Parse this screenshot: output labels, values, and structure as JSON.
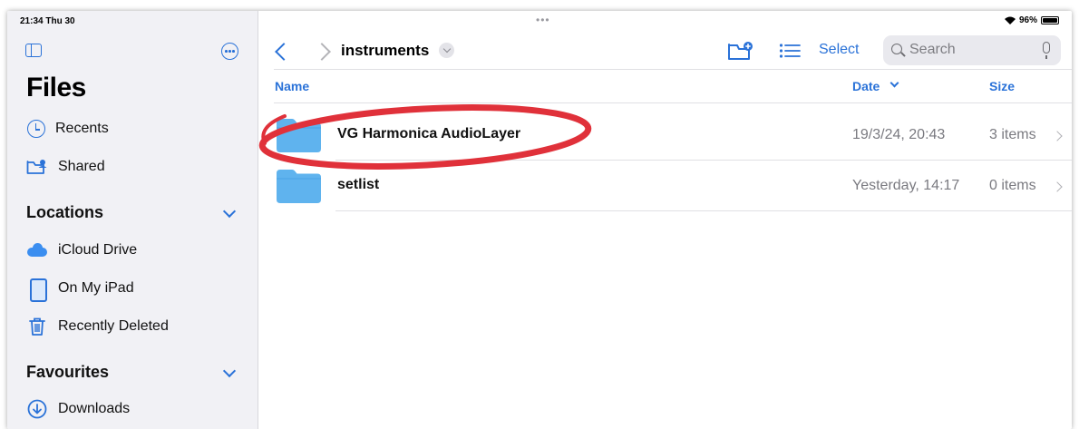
{
  "status": {
    "time": "21:34  Thu 30",
    "battery": "96%",
    "multitask_dots": "•••"
  },
  "sidebar": {
    "title": "Files",
    "items_top": [
      {
        "label": "Recents",
        "icon": "clock-icon"
      },
      {
        "label": "Shared",
        "icon": "shared-folder-icon"
      }
    ],
    "locations": {
      "title": "Locations",
      "items": [
        {
          "label": "iCloud Drive",
          "icon": "icloud-icon"
        },
        {
          "label": "On My iPad",
          "icon": "ipad-icon"
        },
        {
          "label": "Recently Deleted",
          "icon": "trash-icon"
        }
      ]
    },
    "favourites": {
      "title": "Favourites",
      "items": [
        {
          "label": "Downloads",
          "icon": "download-icon"
        }
      ]
    }
  },
  "toolbar": {
    "folder_title": "instruments",
    "select_label": "Select",
    "search_placeholder": "Search"
  },
  "columns": {
    "name": "Name",
    "date": "Date",
    "size": "Size"
  },
  "rows": [
    {
      "name": "VG Harmonica AudioLayer",
      "date": "19/3/24, 20:43",
      "size": "3 items"
    },
    {
      "name": "setlist",
      "date": "Yesterday, 14:17",
      "size": "0 items"
    }
  ],
  "colors": {
    "accent": "#2a72d8",
    "folder": "#5fb3ee",
    "highlight": "#e0313a"
  }
}
